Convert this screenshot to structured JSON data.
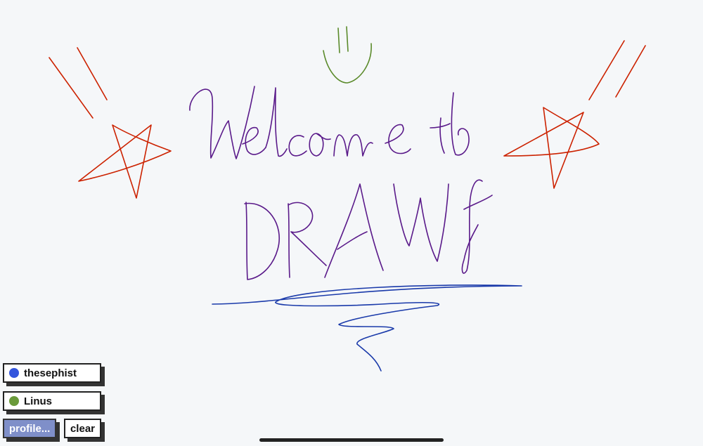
{
  "users": [
    {
      "name": "thesephist",
      "color": "#3355dd"
    },
    {
      "name": "Linus",
      "color": "#6a9a3a"
    }
  ],
  "buttons": {
    "profile": "profile...",
    "clear": "clear"
  },
  "stroke_colors": {
    "purple": "#5a1a8a",
    "red": "#cc2200",
    "green": "#5a8a2a",
    "blue": "#1a3aaa"
  },
  "drawing_text": "Welcome to DRAWf"
}
